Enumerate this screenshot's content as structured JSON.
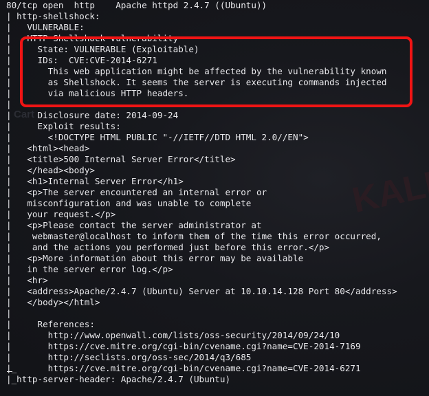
{
  "terminal": {
    "lines": [
      "80/tcp open  http    Apache httpd 2.4.7 ((Ubuntu))",
      "| http-shellshock:",
      "|   VULNERABLE:",
      "|   HTTP Shellshock vulnerability",
      "|     State: VULNERABLE (Exploitable)",
      "|     IDs:  CVE:CVE-2014-6271",
      "|       This web application might be affected by the vulnerability known",
      "|       as Shellshock. It seems the server is executing commands injected",
      "|       via malicious HTTP headers.",
      "|",
      "|     Disclosure date: 2014-09-24",
      "|     Exploit results:",
      "|       <!DOCTYPE HTML PUBLIC \"-//IETF//DTD HTML 2.0//EN\">",
      "|   <html><head>",
      "|   <title>500 Internal Server Error</title>",
      "|   </head><body>",
      "|   <h1>Internal Server Error</h1>",
      "|   <p>The server encountered an internal error or",
      "|   misconfiguration and was unable to complete",
      "|   your request.</p>",
      "|   <p>Please contact the server administrator at",
      "|    webmaster@localhost to inform them of the time this error occurred,",
      "|    and the actions you performed just before this error.</p>",
      "|   <p>More information about this error may be available",
      "|   in the server error log.</p>",
      "|   <hr>",
      "|   <address>Apache/2.4.7 (Ubuntu) Server at 10.10.14.128 Port 80</address>",
      "|   </body></html>",
      "|",
      "|     References:",
      "|       http://www.openwall.com/lists/oss-security/2014/09/24/10",
      "|       https://cve.mitre.org/cgi-bin/cvename.cgi?name=CVE-2014-7169",
      "|       http://seclists.org/oss-sec/2014/q3/685",
      "|_      https://cve.mitre.org/cgi-bin/cvename.cgi?name=CVE-2014-6271",
      "|_http-server-header: Apache/2.4.7 (Ubuntu)"
    ],
    "background_marks": [
      "Cart",
      "KALI"
    ],
    "colors": {
      "text": "#e9e9ec",
      "background": "#141418",
      "highlight_border": "#f01414"
    }
  }
}
